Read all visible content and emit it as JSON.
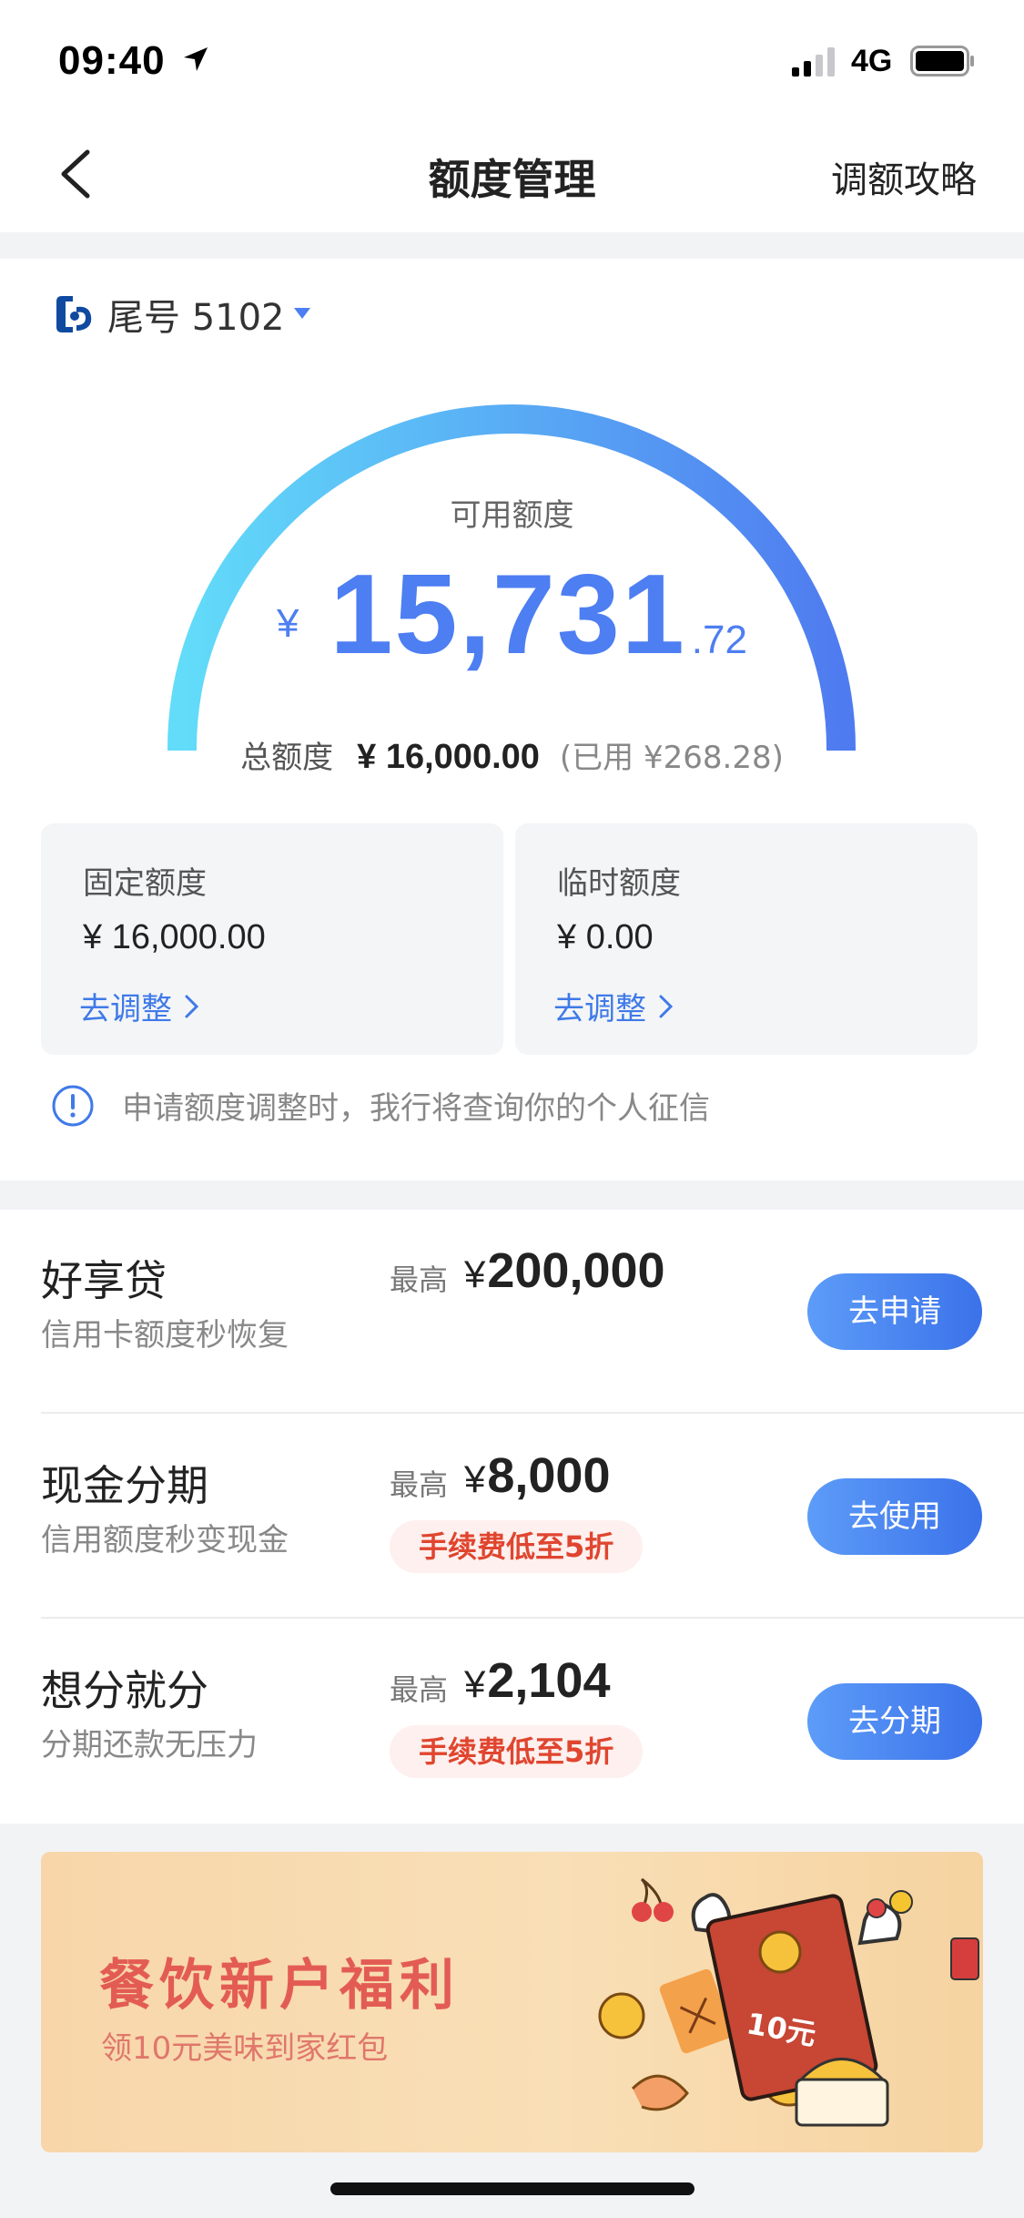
{
  "status_bar": {
    "time": "09:40",
    "network": "4G"
  },
  "nav": {
    "title": "额度管理",
    "right_link": "调额攻略"
  },
  "card": {
    "label": "尾号 5102"
  },
  "available": {
    "label": "可用额度",
    "currency": "¥",
    "integer": "15,731",
    "decimal": ".72",
    "gauge_fill_fraction": 1.0
  },
  "total": {
    "label": "总额度",
    "value": "¥ 16,000.00",
    "used": "(已用 ¥268.28)"
  },
  "quotas": [
    {
      "title": "固定额度",
      "value": "¥ 16,000.00",
      "link": "去调整"
    },
    {
      "title": "临时额度",
      "value": "¥ 0.00",
      "link": "去调整"
    }
  ],
  "notice": "申请额度调整时，我行将查询你的个人征信",
  "products": [
    {
      "title": "好享贷",
      "subtitle": "信用卡额度秒恢复",
      "max_label": "最高",
      "currency": "¥",
      "amount": "200,000",
      "badge": "",
      "button": "去申请"
    },
    {
      "title": "现金分期",
      "subtitle": "信用额度秒变现金",
      "max_label": "最高",
      "currency": "¥",
      "amount": "8,000",
      "badge": "手续费低至5折",
      "button": "去使用"
    },
    {
      "title": "想分就分",
      "subtitle": "分期还款无压力",
      "max_label": "最高",
      "currency": "¥",
      "amount": "2,104",
      "badge": "手续费低至5折",
      "button": "去分期"
    }
  ],
  "banner": {
    "title": "餐饮新户福利",
    "subtitle": "领10元美味到家红包",
    "envelope_text": "10元"
  },
  "colors": {
    "accent": "#4d7ef2",
    "gauge_start": "#62dcf9",
    "gauge_end": "#4f7bf0",
    "badge_text": "#e0452f",
    "banner_title": "#e35c53"
  }
}
